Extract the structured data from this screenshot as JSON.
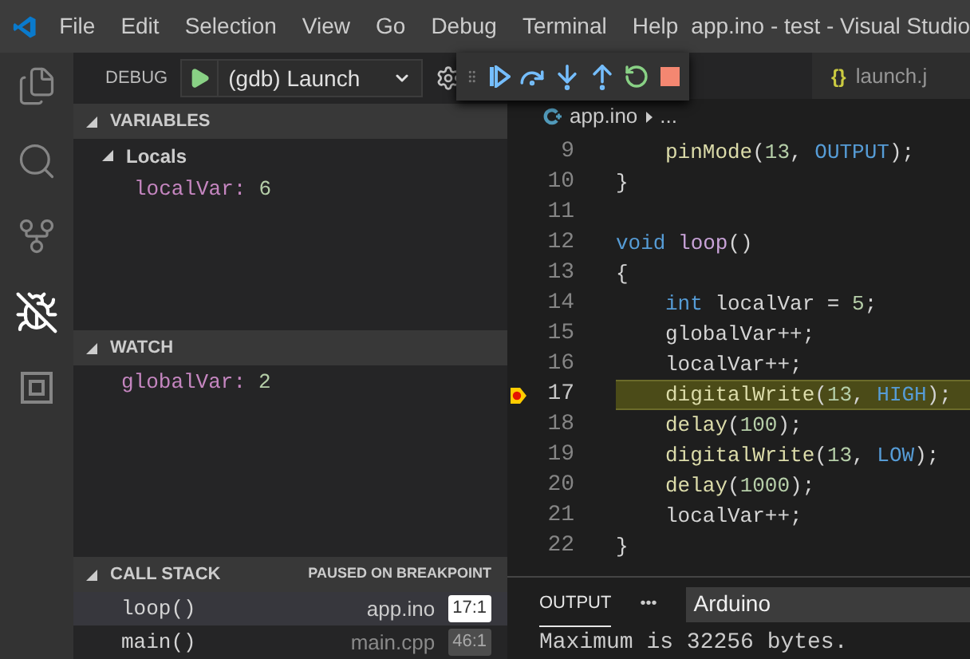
{
  "title_bar": {
    "menu": [
      "File",
      "Edit",
      "Selection",
      "View",
      "Go",
      "Debug",
      "Terminal",
      "Help"
    ],
    "title": "app.ino - test - Visual Studio"
  },
  "activity_bar": [
    {
      "kind": "files",
      "selected": false
    },
    {
      "kind": "search",
      "selected": false
    },
    {
      "kind": "source-control",
      "selected": false
    },
    {
      "kind": "debug",
      "selected": true
    },
    {
      "kind": "extensions",
      "selected": false
    }
  ],
  "debug_toolbar": {
    "label": "DEBUG",
    "configuration": "(gdb) Launch"
  },
  "floating_toolbar": [
    {
      "kind": "continue"
    },
    {
      "kind": "step-over"
    },
    {
      "kind": "step-into"
    },
    {
      "kind": "step-out"
    },
    {
      "kind": "restart"
    },
    {
      "kind": "stop"
    }
  ],
  "variables": {
    "title": "VARIABLES",
    "scopes": [
      {
        "name": "Locals",
        "expanded": true,
        "children": [
          {
            "name": "localVar:",
            "value": "6"
          }
        ]
      }
    ]
  },
  "watch": {
    "title": "WATCH",
    "items": [
      {
        "name": "globalVar:",
        "value": "2"
      }
    ]
  },
  "call_stack": {
    "title": "CALL STACK",
    "status": "PAUSED ON BREAKPOINT",
    "frames": [
      {
        "function": "loop()",
        "file": "app.ino",
        "position": "17:1",
        "selected": true
      },
      {
        "function": "main()",
        "file": "main.cpp",
        "position": "46:1",
        "selected": false
      }
    ]
  },
  "editor": {
    "tabs": [
      {
        "icon_text": "{}",
        "label": "launch.j"
      }
    ],
    "breadcrumb": {
      "file": "app.ino",
      "more": "..."
    },
    "lines": [
      {
        "number": "9",
        "current": false,
        "breakpoint": false,
        "indented": true,
        "tokens": [
          {
            "text": "pinMode",
            "kind": "fn"
          },
          {
            "text": "(",
            "kind": "plain"
          },
          {
            "text": "13",
            "kind": "num"
          },
          {
            "text": ", ",
            "kind": "plain"
          },
          {
            "text": "OUTPUT",
            "kind": "const"
          },
          {
            "text": ");",
            "kind": "plain"
          }
        ]
      },
      {
        "number": "10",
        "current": false,
        "breakpoint": false,
        "indented": false,
        "tokens": [
          {
            "text": "}",
            "kind": "plain"
          }
        ]
      },
      {
        "number": "11",
        "current": false,
        "breakpoint": false
      },
      {
        "number": "12",
        "current": false,
        "breakpoint": false,
        "indented": false,
        "tokens": [
          {
            "text": "void",
            "kind": "kw"
          },
          {
            "text": " loop",
            "kind": "def"
          },
          {
            "text": "()",
            "kind": "plain"
          }
        ]
      },
      {
        "number": "13",
        "current": false,
        "breakpoint": false,
        "indented": false,
        "tokens": [
          {
            "text": "{",
            "kind": "plain"
          }
        ]
      },
      {
        "number": "14",
        "current": false,
        "breakpoint": false,
        "indented": true,
        "tokens": [
          {
            "text": "int",
            "kind": "kw"
          },
          {
            "text": " localVar = ",
            "kind": "plain"
          },
          {
            "text": "5",
            "kind": "num"
          },
          {
            "text": ";",
            "kind": "plain"
          }
        ]
      },
      {
        "number": "15",
        "current": false,
        "breakpoint": false,
        "indented": true,
        "tokens": [
          {
            "text": "globalVar++;",
            "kind": "plain"
          }
        ]
      },
      {
        "number": "16",
        "current": false,
        "breakpoint": false,
        "indented": true,
        "tokens": [
          {
            "text": "localVar++;",
            "kind": "plain"
          }
        ]
      },
      {
        "number": "17",
        "current": true,
        "breakpoint": true,
        "indented": true,
        "tokens": [
          {
            "text": "digitalWrite",
            "kind": "fn"
          },
          {
            "text": "(",
            "kind": "plain"
          },
          {
            "text": "13",
            "kind": "num"
          },
          {
            "text": ", ",
            "kind": "plain"
          },
          {
            "text": "HIGH",
            "kind": "const"
          },
          {
            "text": ");",
            "kind": "plain"
          }
        ]
      },
      {
        "number": "18",
        "current": false,
        "breakpoint": false,
        "indented": true,
        "tokens": [
          {
            "text": "delay",
            "kind": "fn"
          },
          {
            "text": "(",
            "kind": "plain"
          },
          {
            "text": "100",
            "kind": "num"
          },
          {
            "text": ");",
            "kind": "plain"
          }
        ]
      },
      {
        "number": "19",
        "current": false,
        "breakpoint": false,
        "indented": true,
        "tokens": [
          {
            "text": "digitalWrite",
            "kind": "fn"
          },
          {
            "text": "(",
            "kind": "plain"
          },
          {
            "text": "13",
            "kind": "num"
          },
          {
            "text": ", ",
            "kind": "plain"
          },
          {
            "text": "LOW",
            "kind": "const"
          },
          {
            "text": ");",
            "kind": "plain"
          }
        ]
      },
      {
        "number": "20",
        "current": false,
        "breakpoint": false,
        "indented": true,
        "tokens": [
          {
            "text": "delay",
            "kind": "fn"
          },
          {
            "text": "(",
            "kind": "plain"
          },
          {
            "text": "1000",
            "kind": "num"
          },
          {
            "text": ");",
            "kind": "plain"
          }
        ]
      },
      {
        "number": "21",
        "current": false,
        "breakpoint": false,
        "indented": true,
        "tokens": [
          {
            "text": "localVar++;",
            "kind": "plain"
          }
        ]
      },
      {
        "number": "22",
        "current": false,
        "breakpoint": false,
        "indented": false,
        "tokens": [
          {
            "text": "}",
            "kind": "plain"
          }
        ]
      }
    ]
  },
  "panel": {
    "tabs": [
      {
        "label": "OUTPUT",
        "selected": true
      }
    ],
    "more": "•••",
    "channel": "Arduino",
    "output": "Maximum is 32256 bytes."
  }
}
